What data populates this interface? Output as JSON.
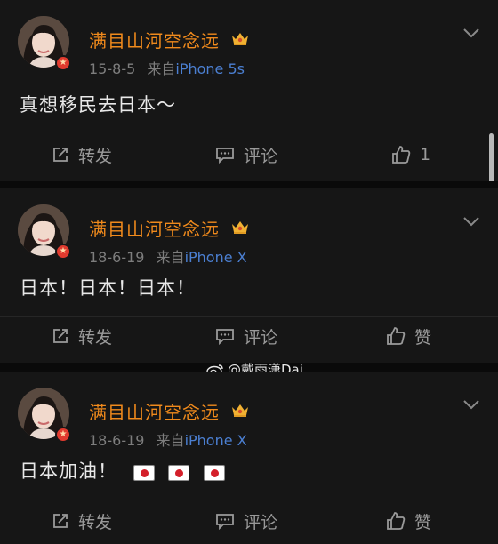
{
  "posts": [
    {
      "username": "满目山河空念远",
      "date": "15-8-5",
      "source_prefix": "来自",
      "source": "iPhone 5s",
      "content": "真想移民去日本～",
      "flags": 0,
      "repost_label": "转发",
      "comment_label": "评论",
      "like_label": "1"
    },
    {
      "username": "满目山河空念远",
      "date": "18-6-19",
      "source_prefix": "来自",
      "source": "iPhone X",
      "content": "日本！日本！日本！",
      "flags": 0,
      "repost_label": "转发",
      "comment_label": "评论",
      "like_label": "赞"
    },
    {
      "username": "满目山河空念远",
      "date": "18-6-19",
      "source_prefix": "来自",
      "source": "iPhone X",
      "content": "日本加油！",
      "flags": 3,
      "repost_label": "转发",
      "comment_label": "评论",
      "like_label": "赞"
    }
  ],
  "watermark": {
    "text": "@戴雨潇Dai",
    "icon": "weibo-logo-icon"
  },
  "colors": {
    "background": "#161616",
    "username": "#f08a1c",
    "source_link": "#4b7fd1",
    "action_text": "#9a9a9a",
    "badge": "#e03a2e"
  }
}
